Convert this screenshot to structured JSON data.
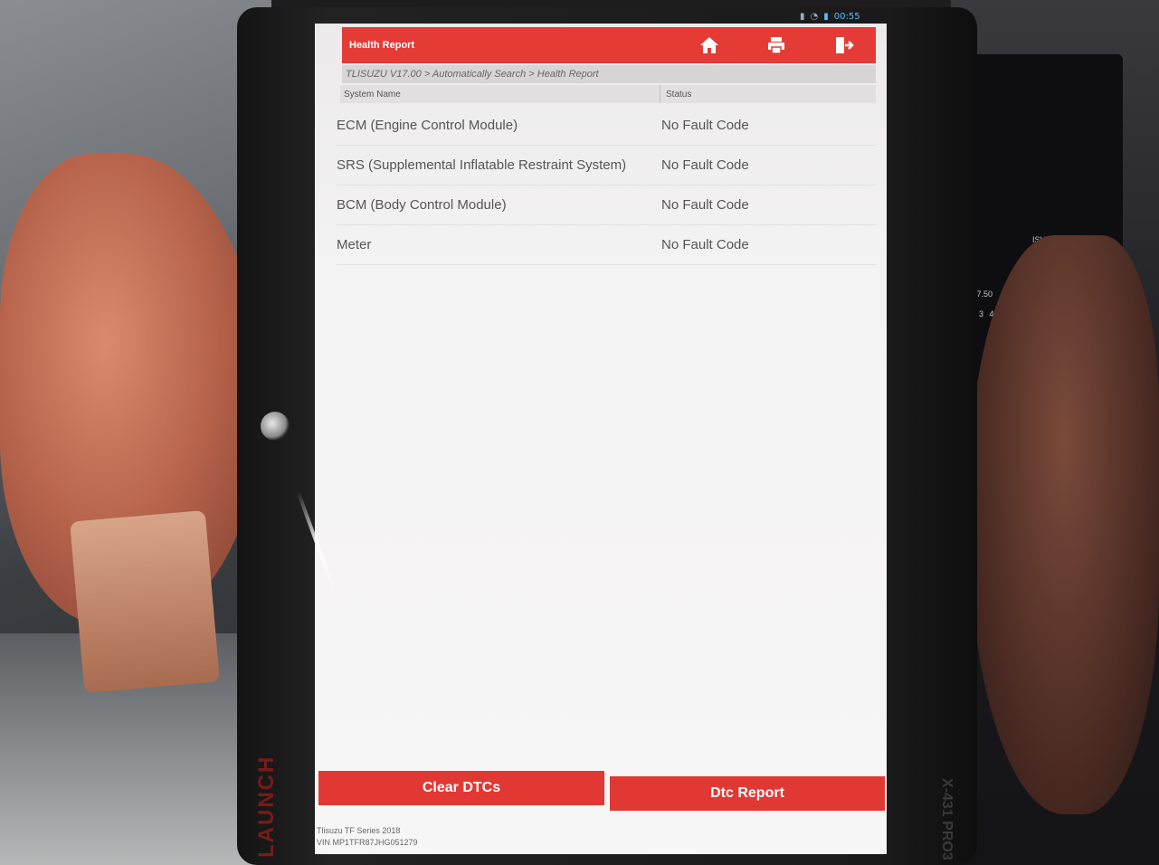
{
  "system_bar": {
    "time": "00:55"
  },
  "header": {
    "title": "Health Report",
    "icons": [
      "home-icon",
      "printer-icon",
      "exit-icon"
    ]
  },
  "breadcrumb": "TLISUZU V17.00 > Automatically Search > Health Report",
  "table": {
    "columns": [
      "System Name",
      "Status"
    ],
    "rows": [
      {
        "name": "ECM (Engine Control Module)",
        "status": "No Fault Code"
      },
      {
        "name": "SRS (Supplemental Inflatable Restraint System)",
        "status": "No Fault Code"
      },
      {
        "name": "BCM (Body Control Module)",
        "status": "No Fault Code"
      },
      {
        "name": "Meter",
        "status": "No Fault Code"
      }
    ]
  },
  "buttons": {
    "clear_dtcs": "Clear DTCs",
    "dtc_report": "Dtc Report"
  },
  "footer": {
    "vehicle": "Tlisuzu TF Series 2018",
    "vin": "VIN MP1TFR87JHG051279"
  },
  "device": {
    "brand": "LAUNCH",
    "model": "X-431 PRO3"
  },
  "background_text": {
    "car_brand": "ISUZU",
    "radio": "CH 87.50",
    "presets": "1 2 3 4 5 6"
  },
  "colors": {
    "accent": "#e43b36"
  }
}
